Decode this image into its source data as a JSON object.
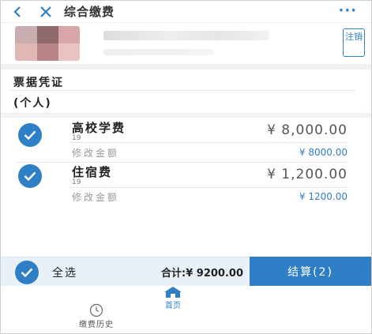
{
  "nav": {
    "title": "综合缴费",
    "more": "···"
  },
  "profile": {
    "logout_label": "注销"
  },
  "receipt": {
    "section_title": "票据凭证",
    "type": "(个人)"
  },
  "items": [
    {
      "name": "高校学费",
      "code": "19",
      "amount": "¥ 8,000.00",
      "modify_label": "修改金额",
      "modify_value": "¥ 8000.00",
      "checked": true
    },
    {
      "name": "住宿费",
      "code": "19",
      "amount": "¥ 1,200.00",
      "modify_label": "修改金额",
      "modify_value": "¥ 1200.00",
      "checked": true
    }
  ],
  "bottom": {
    "select_all": "全选",
    "total": "合计:¥ 9200.00",
    "checkout": "结算(2)"
  },
  "tabs": {
    "home": "首页",
    "history": "缴费历史"
  },
  "colors": {
    "accent": "#2f7fc6",
    "bottom_bar": "#e9f1f8"
  }
}
